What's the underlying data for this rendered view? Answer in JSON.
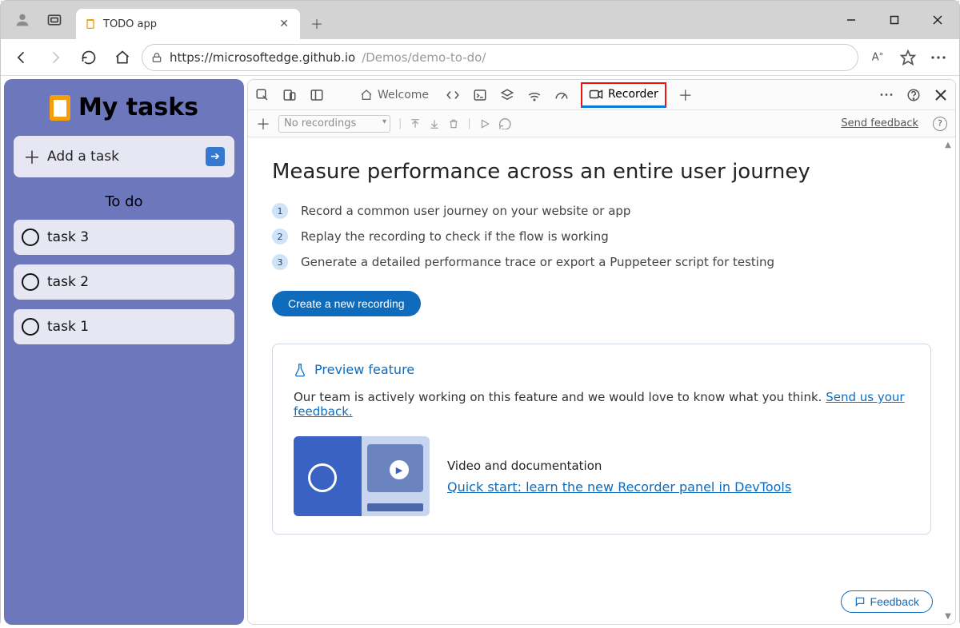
{
  "browser": {
    "tab_title": "TODO app",
    "url_host": "https://microsoftedge.github.io",
    "url_path": "/Demos/demo-to-do/"
  },
  "app": {
    "title": "My tasks",
    "add_task_label": "Add a task",
    "section_label": "To do",
    "tasks": [
      "task 3",
      "task 2",
      "task 1"
    ]
  },
  "devtools": {
    "tabs": {
      "welcome": "Welcome",
      "recorder": "Recorder"
    },
    "subbar": {
      "dropdown": "No recordings",
      "feedback_link": "Send feedback"
    },
    "panel": {
      "heading": "Measure performance across an entire user journey",
      "steps": [
        "Record a common user journey on your website or app",
        "Replay the recording to check if the flow is working",
        "Generate a detailed performance trace or export a Puppeteer script for testing"
      ],
      "create_btn": "Create a new recording",
      "preview": {
        "title": "Preview feature",
        "text_before_link": "Our team is actively working on this feature and we would love to know what you think. ",
        "link": "Send us your feedback.",
        "video_heading": "Video and documentation",
        "video_link": "Quick start: learn the new Recorder panel in DevTools"
      },
      "feedback_btn": "Feedback"
    }
  }
}
